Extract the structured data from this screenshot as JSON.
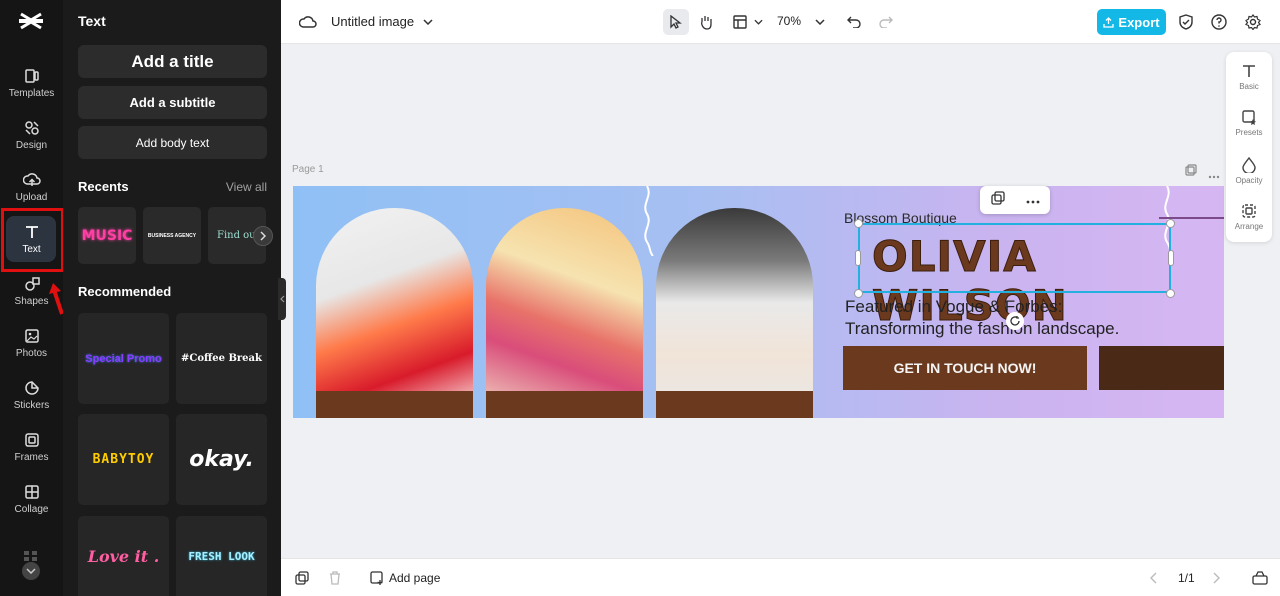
{
  "rail": {
    "items": [
      {
        "label": "Templates"
      },
      {
        "label": "Design"
      },
      {
        "label": "Upload"
      },
      {
        "label": "Text"
      },
      {
        "label": "Shapes"
      },
      {
        "label": "Photos"
      },
      {
        "label": "Stickers"
      },
      {
        "label": "Frames"
      },
      {
        "label": "Collage"
      }
    ],
    "active": "Text"
  },
  "panel": {
    "title": "Text",
    "add_title": "Add a title",
    "add_subtitle": "Add a subtitle",
    "add_body": "Add body text",
    "recents_title": "Recents",
    "view_all": "View all",
    "recents": [
      "MUSIC",
      "BUSINESS AGENCY",
      "Find out"
    ],
    "recommended_title": "Recommended",
    "recommended": [
      "Special Promo",
      "#Coffee Break",
      "BABYTOY",
      "okay.",
      "Love it .",
      "FRESH LOOK"
    ]
  },
  "topbar": {
    "doc_title": "Untitled image",
    "zoom": "70%",
    "export_label": "Export"
  },
  "canvas": {
    "page_label": "Page 1",
    "brand": "Blossom Boutique",
    "name": "OLIVIA WILSON",
    "featured_line1": "Featured in Vogue & Forbes:",
    "featured_line2": "Transforming the fashion landscape.",
    "cta": "GET IN TOUCH NOW!"
  },
  "right_panel": {
    "items": [
      {
        "label": "Basic",
        "icon": "text-icon"
      },
      {
        "label": "Presets",
        "icon": "presets-icon"
      },
      {
        "label": "Opacity",
        "icon": "opacity-icon"
      },
      {
        "label": "Arrange",
        "icon": "arrange-icon"
      }
    ]
  },
  "bottombar": {
    "add_page": "Add page",
    "pager": "1/1"
  },
  "colors": {
    "accent": "#14b8e6",
    "brown": "#6b3a1e",
    "highlight": "#e01010"
  }
}
